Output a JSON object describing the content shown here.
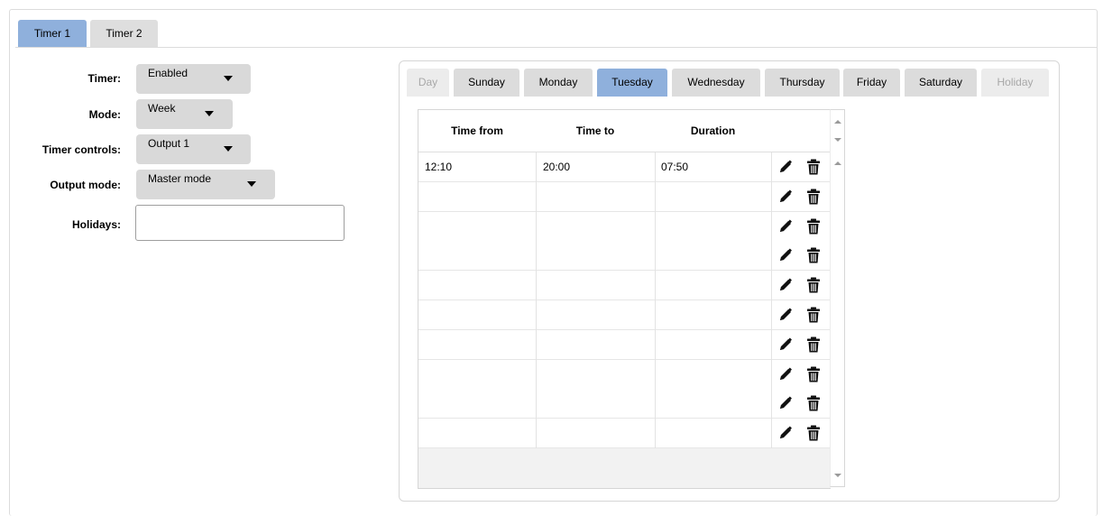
{
  "timer_tabs": [
    {
      "label": "Timer 1",
      "active": true
    },
    {
      "label": "Timer 2",
      "active": false
    }
  ],
  "form": {
    "timer": {
      "label": "Timer:",
      "value": "Enabled"
    },
    "mode": {
      "label": "Mode:",
      "value": "Week"
    },
    "timer_controls": {
      "label": "Timer controls:",
      "value": "Output 1"
    },
    "output_mode": {
      "label": "Output mode:",
      "value": "Master mode"
    },
    "holidays": {
      "label": "Holidays:",
      "value": "",
      "placeholder": ""
    }
  },
  "day_tabs": [
    {
      "label": "Day",
      "state": "disabled"
    },
    {
      "label": "Sunday",
      "state": "normal"
    },
    {
      "label": "Monday",
      "state": "normal"
    },
    {
      "label": "Tuesday",
      "state": "active"
    },
    {
      "label": "Wednesday",
      "state": "normal"
    },
    {
      "label": "Thursday",
      "state": "normal"
    },
    {
      "label": "Friday",
      "state": "normal"
    },
    {
      "label": "Saturday",
      "state": "normal"
    },
    {
      "label": "Holiday",
      "state": "disabled"
    }
  ],
  "table": {
    "columns": [
      "Time from",
      "Time to",
      "Duration"
    ],
    "rows": [
      {
        "from": "12:10",
        "to": "20:00",
        "duration": "07:50"
      },
      {
        "from": "",
        "to": "",
        "duration": ""
      },
      {
        "from": "",
        "to": "",
        "duration": ""
      },
      {
        "from": "",
        "to": "",
        "duration": ""
      },
      {
        "from": "",
        "to": "",
        "duration": ""
      },
      {
        "from": "",
        "to": "",
        "duration": ""
      },
      {
        "from": "",
        "to": "",
        "duration": ""
      },
      {
        "from": "",
        "to": "",
        "duration": ""
      },
      {
        "from": "",
        "to": "",
        "duration": ""
      },
      {
        "from": "",
        "to": "",
        "duration": ""
      }
    ],
    "row_actions": [
      "pencil-icon",
      "trash-icon"
    ]
  },
  "colors": {
    "active_tab": "#8fb0dc",
    "inactive_tab": "#dedede",
    "select_bg": "#d9d9d9",
    "disabled_text": "#a8a8a8"
  }
}
